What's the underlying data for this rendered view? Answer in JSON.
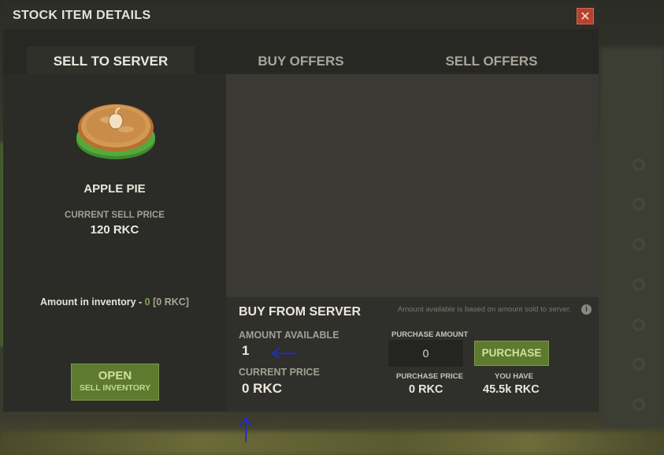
{
  "window": {
    "title": "STOCK ITEM DETAILS",
    "close_label": "✕"
  },
  "tabs": [
    {
      "label": "SELL TO SERVER",
      "active": true
    },
    {
      "label": "BUY OFFERS",
      "active": false
    },
    {
      "label": "SELL OFFERS",
      "active": false
    }
  ],
  "item": {
    "name": "APPLE PIE",
    "icon": "apple-pie-icon",
    "sell_price_label": "CURRENT SELL PRICE",
    "sell_price": "120 RKC",
    "inventory_label": "Amount in inventory - ",
    "inventory_count": "0",
    "inventory_value": "[0 RKC]"
  },
  "open_button": {
    "label": "OPEN",
    "sublabel": "SELL INVENTORY"
  },
  "buy_from_server": {
    "heading": "BUY FROM SERVER",
    "note": "Amount available is based on amount sold to server.",
    "info_icon": "i",
    "amount_available_label": "AMOUNT AVAILABLE",
    "amount_available": "1",
    "current_price_label": "CURRENT PRICE",
    "current_price": "0 RKC",
    "purchase_amount_label": "PURCHASE AMOUNT",
    "purchase_amount_value": "0",
    "purchase_button": "PURCHASE",
    "purchase_price_label": "PURCHASE PRICE",
    "purchase_price": "0 RKC",
    "you_have_label": "YOU HAVE",
    "you_have": "45.5k RKC"
  },
  "colors": {
    "accent_green": "#5e7a2e",
    "close_red": "#b8412c",
    "inventory_count_green": "#7fa84a"
  }
}
